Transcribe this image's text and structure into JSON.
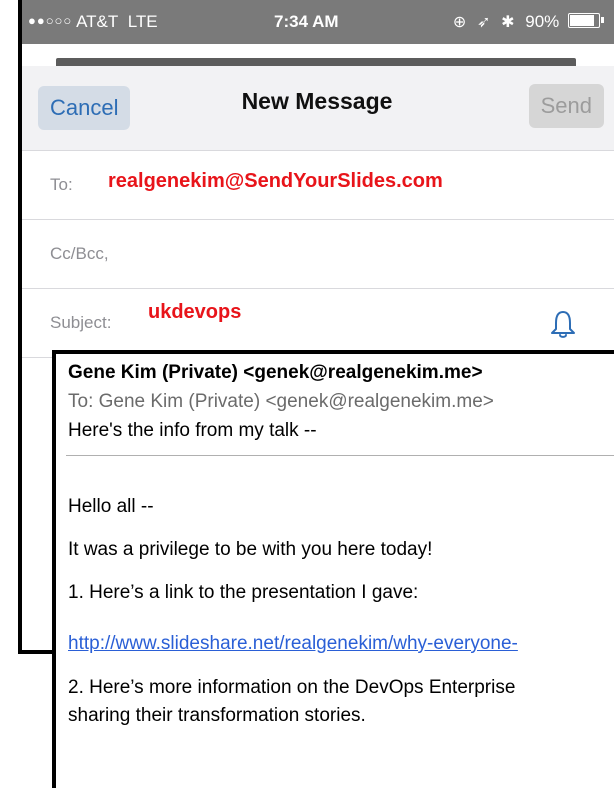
{
  "status_bar": {
    "signal": "●●○○○",
    "carrier": "AT&T",
    "network": "LTE",
    "time": "7:34 AM",
    "battery": "90%",
    "battery_level": 0.9
  },
  "nav": {
    "cancel_label": "Cancel",
    "title": "New Message",
    "send_label": "Send"
  },
  "fields": {
    "to_label": "To:",
    "to_value": "realgenekim@SendYourSlides.com",
    "cc_label": "Cc/Bcc,",
    "subject_label": "Subject:",
    "subject_value": "ukdevops"
  },
  "email": {
    "from": "Gene Kim (Private) <genek@realgenekim.me>",
    "to": "To:  Gene Kim (Private) <genek@realgenekim.me>",
    "subject": "Here's the info from my talk --",
    "lines": [
      "Hello all --",
      "It was a privilege to be with you here today!",
      "1. Here’s a link to the presentation I gave:",
      "http://www.slideshare.net/realgenekim/why-everyone-",
      "2. Here’s more information on the DevOps Enterprise",
      "sharing their transformation stories."
    ]
  },
  "colors": {
    "highlight_red": "#e8141a",
    "ios_blue": "#2d6db5",
    "link_blue": "#2a5fd6"
  }
}
